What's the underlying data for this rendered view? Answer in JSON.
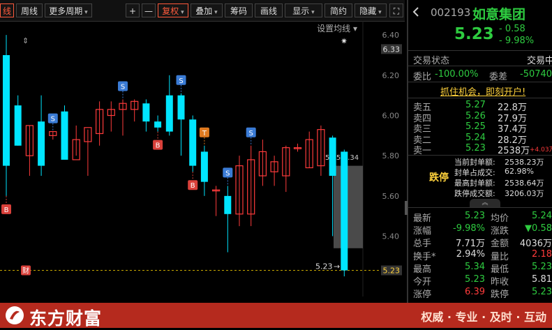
{
  "toolbar": {
    "items": [
      {
        "label": "线",
        "active": true
      },
      {
        "label": "周线"
      },
      {
        "label": "更多周期",
        "dropdown": true
      },
      {
        "label": "+"
      },
      {
        "label": "—"
      },
      {
        "label": "复权",
        "dropdown": true,
        "active": true
      },
      {
        "label": "叠加",
        "dropdown": true
      },
      {
        "label": "筹码"
      },
      {
        "label": "画线"
      },
      {
        "label": "显示",
        "dropdown": true
      },
      {
        "label": "简约"
      },
      {
        "label": "隐藏",
        "dropdown": true
      }
    ],
    "settings_label": "设置均线"
  },
  "chart_data": {
    "type": "candlestick",
    "y_ticks": [
      "6.40",
      "6.20",
      "6.00",
      "5.80",
      "5.60",
      "5.40"
    ],
    "ylim": [
      5.1,
      6.47
    ],
    "current_price_label": "6.33",
    "last_price_label": "5.23",
    "price_line_label": "5.23",
    "range_label": "5.75-5.34",
    "candles": [
      {
        "o": 6.3,
        "h": 6.4,
        "l": 5.6,
        "c": 5.75
      },
      {
        "o": 6.05,
        "h": 6.1,
        "l": 5.85,
        "c": 5.85
      },
      {
        "o": 5.8,
        "h": 5.95,
        "l": 5.7,
        "c": 5.95
      },
      {
        "o": 5.97,
        "h": 6.1,
        "l": 5.7,
        "c": 5.75
      },
      {
        "o": 5.9,
        "h": 5.92,
        "l": 5.88,
        "c": 5.92
      },
      {
        "o": 6.02,
        "h": 6.05,
        "l": 5.85,
        "c": 5.78
      },
      {
        "o": 5.78,
        "h": 5.95,
        "l": 5.8,
        "c": 5.88
      },
      {
        "o": 5.87,
        "h": 5.93,
        "l": 5.7,
        "c": 5.94
      },
      {
        "o": 5.91,
        "h": 6.07,
        "l": 5.85,
        "c": 6.03
      },
      {
        "o": 6.0,
        "h": 6.07,
        "l": 5.92,
        "c": 6.03
      },
      {
        "o": 6.03,
        "h": 6.08,
        "l": 5.9,
        "c": 6.06
      },
      {
        "o": 6.03,
        "h": 6.08,
        "l": 5.97,
        "c": 6.07
      },
      {
        "o": 6.06,
        "h": 6.08,
        "l": 5.92,
        "c": 5.97
      },
      {
        "o": 5.97,
        "h": 6.0,
        "l": 5.92,
        "c": 5.94
      },
      {
        "o": 6.1,
        "h": 6.2,
        "l": 5.9,
        "c": 5.92
      },
      {
        "o": 6.1,
        "h": 6.11,
        "l": 5.8,
        "c": 5.98
      },
      {
        "o": 5.98,
        "h": 6.0,
        "l": 5.72,
        "c": 5.75
      },
      {
        "o": 5.82,
        "h": 5.85,
        "l": 5.6,
        "c": 5.67
      },
      {
        "o": 5.63,
        "h": 5.65,
        "l": 5.5,
        "c": 5.63
      },
      {
        "o": 5.6,
        "h": 5.65,
        "l": 5.32,
        "c": 5.51
      },
      {
        "o": 5.51,
        "h": 5.8,
        "l": 5.45,
        "c": 5.75
      },
      {
        "o": 5.51,
        "h": 5.85,
        "l": 5.45,
        "c": 5.78
      },
      {
        "o": 5.7,
        "h": 5.88,
        "l": 5.65,
        "c": 5.82
      },
      {
        "o": 5.72,
        "h": 5.8,
        "l": 5.65,
        "c": 5.77
      },
      {
        "o": 5.7,
        "h": 5.85,
        "l": 5.62,
        "c": 5.84
      },
      {
        "o": 5.84,
        "h": 5.86,
        "l": 5.82,
        "c": 5.84
      },
      {
        "o": 5.74,
        "h": 5.92,
        "l": 5.74,
        "c": 5.88
      },
      {
        "o": 5.75,
        "h": 5.95,
        "l": 5.7,
        "c": 5.93
      },
      {
        "o": 5.89,
        "h": 5.9,
        "l": 5.4,
        "c": 5.7
      },
      {
        "o": 5.82,
        "h": 5.83,
        "l": 5.2,
        "c": 5.23
      }
    ],
    "markers": [
      {
        "candle": 4,
        "label": "S",
        "pos": "above"
      },
      {
        "candle": 10,
        "label": "S",
        "pos": "above"
      },
      {
        "candle": 15,
        "label": "S",
        "pos": "above"
      },
      {
        "candle": 19,
        "label": "S",
        "pos": "above"
      },
      {
        "candle": 21,
        "label": "S",
        "pos": "above"
      },
      {
        "candle": 0,
        "label": "B",
        "pos": "below"
      },
      {
        "candle": 13,
        "label": "B",
        "pos": "below"
      },
      {
        "candle": 16,
        "label": "B",
        "pos": "below"
      },
      {
        "candle": 17,
        "label": "T",
        "pos": "above"
      }
    ],
    "fin_label": "财"
  },
  "panel": {
    "code": "002193",
    "name": "如意集团",
    "price": "5.23",
    "change": "- 0.58",
    "change_pct": "- 9.98%",
    "trade_status_label": "交易状态",
    "trade_status_value": "交易中",
    "weibi_label": "委比",
    "weibi_value": "-100.00%",
    "weicha_label": "委差",
    "weicha_value": "-50740",
    "promo": "抓住机会，即刻开户!",
    "asks": [
      {
        "label": "卖五",
        "price": "5.27",
        "vol": "22.8万"
      },
      {
        "label": "卖四",
        "price": "5.26",
        "vol": "27.9万"
      },
      {
        "label": "卖三",
        "price": "5.25",
        "vol": "37.4万"
      },
      {
        "label": "卖二",
        "price": "5.24",
        "vol": "28.2万"
      },
      {
        "label": "卖一",
        "price": "5.23",
        "vol": "2538万",
        "extra": "+4.03万"
      }
    ],
    "limit_down_label": "跌停",
    "seal_rows": [
      {
        "label": "当前封单额:",
        "value": "2538.23万"
      },
      {
        "label": "封单占成交:",
        "value": "62.98%"
      },
      {
        "label": "最高封单额:",
        "value": "2538.64万"
      },
      {
        "label": "跌停成交额:",
        "value": "3206.03万"
      }
    ],
    "stats": [
      {
        "l1": "最新",
        "v1": "5.23",
        "c1": "green",
        "l2": "均价",
        "v2": "5.24",
        "c2": "green"
      },
      {
        "l1": "涨幅",
        "v1": "-9.98%",
        "c1": "green",
        "l2": "涨跌",
        "v2": "▼0.58",
        "c2": "green"
      },
      {
        "l1": "总手",
        "v1": "7.71万",
        "c1": "white",
        "l2": "金额",
        "v2": "4036万",
        "c2": "white"
      },
      {
        "l1": "换手*",
        "v1": "2.94%",
        "c1": "white",
        "l2": "量比",
        "v2": "2.18",
        "c2": "red"
      },
      {
        "l1": "最高",
        "v1": "5.34",
        "c1": "green",
        "l2": "最低",
        "v2": "5.23",
        "c2": "green"
      },
      {
        "l1": "今开",
        "v1": "5.23",
        "c1": "green",
        "l2": "昨收",
        "v2": "5.81",
        "c2": "white"
      },
      {
        "l1": "涨停",
        "v1": "6.39",
        "c1": "red",
        "l2": "跌停",
        "v2": "5.23",
        "c2": "green"
      }
    ]
  },
  "footer": {
    "logo": "东方财富",
    "slogan": "权威 · 专业 · 及时 · 互动"
  },
  "colors": {
    "up": "#ff3b3b",
    "down": "#00e5ff",
    "accent": "#ff5a3c",
    "footer": "#b52a1e",
    "marker_s": "#3a7bd5",
    "marker_b": "#d9403a"
  }
}
